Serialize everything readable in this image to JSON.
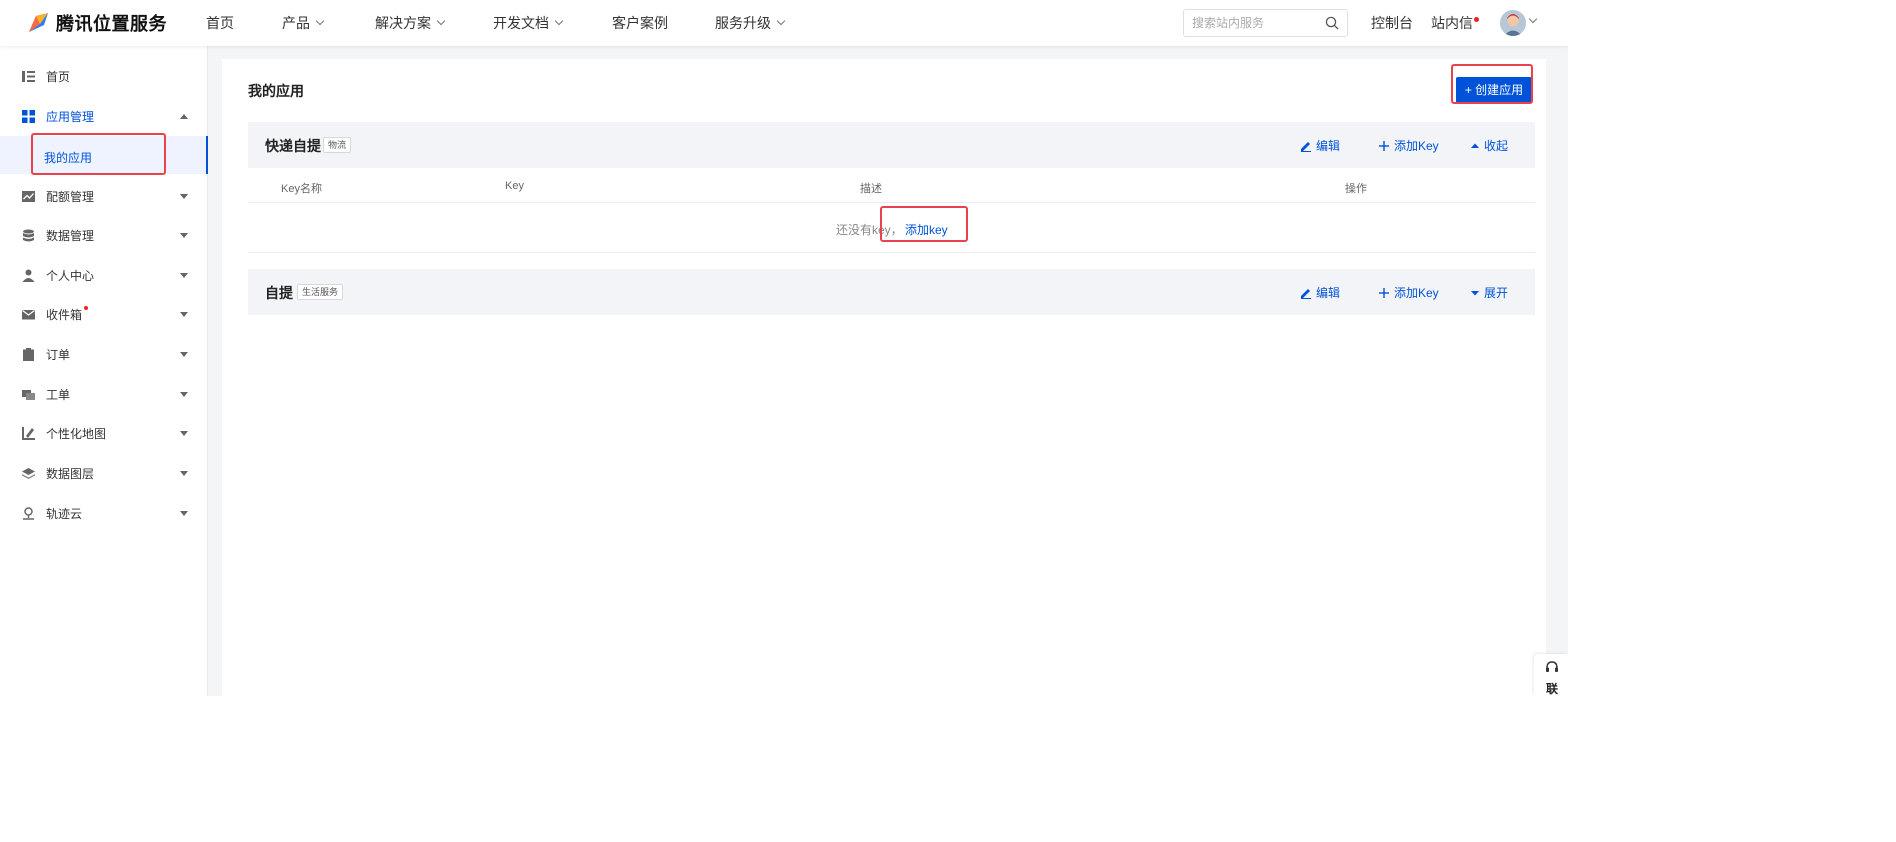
{
  "brand": {
    "name": "腾讯位置服务"
  },
  "nav": {
    "items": [
      {
        "label": "首页",
        "dropdown": false
      },
      {
        "label": "产品",
        "dropdown": true
      },
      {
        "label": "解决方案",
        "dropdown": true
      },
      {
        "label": "开发文档",
        "dropdown": true
      },
      {
        "label": "客户案例",
        "dropdown": false
      },
      {
        "label": "服务升级",
        "dropdown": true
      }
    ],
    "search_placeholder": "搜索站内服务",
    "console_label": "控制台",
    "inbox_label": "站内信"
  },
  "sidebar": {
    "items": [
      {
        "label": "首页",
        "icon": "list-icon"
      },
      {
        "label": "应用管理",
        "icon": "grid-icon",
        "expanded": true
      },
      {
        "label": "配额管理",
        "icon": "chart-icon"
      },
      {
        "label": "数据管理",
        "icon": "database-icon"
      },
      {
        "label": "个人中心",
        "icon": "user-icon"
      },
      {
        "label": "收件箱",
        "icon": "mail-icon",
        "badge_dot": true
      },
      {
        "label": "订单",
        "icon": "clipboard-icon"
      },
      {
        "label": "工单",
        "icon": "ticket-icon"
      },
      {
        "label": "个性化地图",
        "icon": "custom-map-icon"
      },
      {
        "label": "数据图层",
        "icon": "layers-icon"
      },
      {
        "label": "轨迹云",
        "icon": "location-icon"
      }
    ],
    "sub_item": {
      "label": "我的应用"
    }
  },
  "main": {
    "title": "我的应用",
    "create_label": "+ 创建应用",
    "apps": [
      {
        "name": "快递自提",
        "tag": "物流",
        "actions": {
          "edit": "编辑",
          "add_key": "添加Key",
          "toggle": "收起"
        },
        "columns": [
          "Key名称",
          "Key",
          "描述",
          "操作"
        ],
        "empty_text": "还没有key，",
        "empty_link": "添加key"
      },
      {
        "name": "自提",
        "tag": "生活服务",
        "actions": {
          "edit": "编辑",
          "add_key": "添加Key",
          "toggle": "展开"
        }
      }
    ]
  },
  "helper": {
    "label": "联"
  },
  "colors": {
    "accent": "#0052d9",
    "highlight": "#e8424c",
    "badge": "#e22222"
  }
}
